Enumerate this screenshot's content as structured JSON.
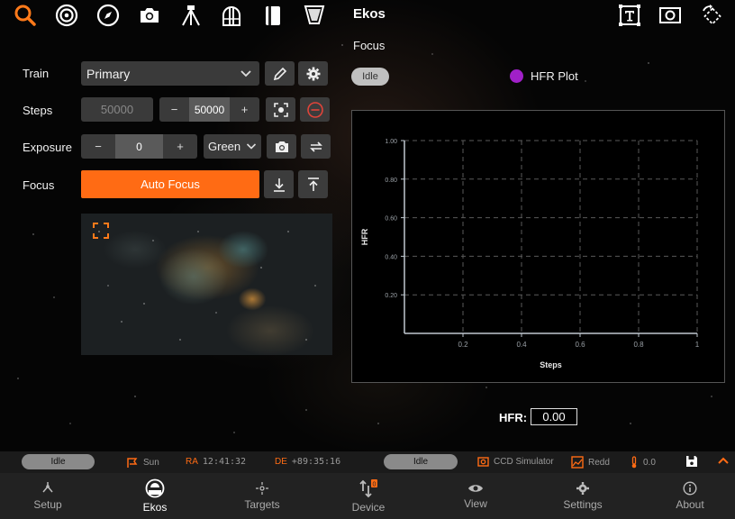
{
  "app": {
    "title": "Ekos"
  },
  "toolbar": {
    "left_icons": [
      "search-icon",
      "target-icon",
      "compass-icon",
      "camera-icon",
      "tripod-icon",
      "observatory-icon",
      "notebook-icon",
      "flat-panel-icon"
    ],
    "right_icons": [
      "text-overlay-icon",
      "capture-frame-icon",
      "rotate-icon"
    ]
  },
  "focus_panel": {
    "train": {
      "label": "Train",
      "value": "Primary"
    },
    "steps": {
      "label": "Steps",
      "absolute_value": "50000",
      "stepper_minus": "−",
      "stepper_value": "50000",
      "stepper_plus": "+"
    },
    "exposure": {
      "label": "Exposure",
      "stepper_minus": "−",
      "value": "0",
      "stepper_plus": "+",
      "filter": "Green"
    },
    "focus": {
      "label": "Focus",
      "auto_focus_label": "Auto Focus"
    }
  },
  "plot_panel": {
    "title": "Focus",
    "status": "Idle",
    "legend": "HFR Plot",
    "legend_color": "#a020c8",
    "hfr_label": "HFR:",
    "hfr_value": "0.00"
  },
  "chart_data": {
    "type": "scatter",
    "title": "",
    "xlabel": "Steps",
    "ylabel": "HFR",
    "xlim": [
      0,
      1
    ],
    "ylim": [
      0,
      1
    ],
    "x_ticks": [
      "0.2",
      "0.4",
      "0.6",
      "0.8",
      "1"
    ],
    "y_ticks": [
      "0.20",
      "0.40",
      "0.60",
      "0.80",
      "1.00"
    ],
    "grid": true,
    "series": [
      {
        "name": "HFR Plot",
        "x": [],
        "y": []
      }
    ]
  },
  "statusbar": {
    "left_status": "Idle",
    "mount_target": "Sun",
    "ra_label": "RA",
    "ra_value": "12:41:32",
    "de_label": "DE",
    "de_value": "+89:35:16",
    "right_status": "Idle",
    "camera": "CCD Simulator",
    "filter": "Redd",
    "temperature": "0.0",
    "accent": "#ff6b14"
  },
  "bottomnav": {
    "items": [
      {
        "label": "Setup",
        "icon": "setup-icon"
      },
      {
        "label": "Ekos",
        "icon": "ekos-icon"
      },
      {
        "label": "Targets",
        "icon": "targets-icon"
      },
      {
        "label": "Device",
        "icon": "device-icon"
      },
      {
        "label": "View",
        "icon": "eye-icon"
      },
      {
        "label": "Settings",
        "icon": "gear-icon"
      },
      {
        "label": "About",
        "icon": "info-icon"
      }
    ]
  }
}
